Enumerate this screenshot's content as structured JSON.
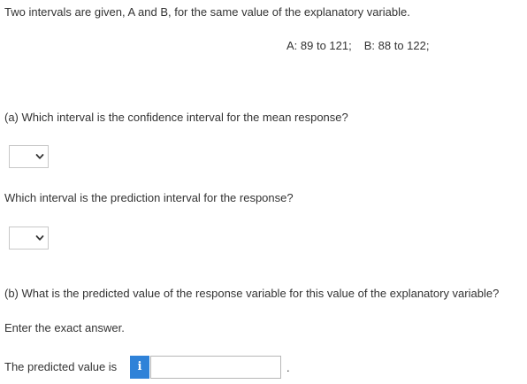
{
  "intro": "Two intervals are given, A and B, for the same value of the explanatory variable.",
  "intervals": {
    "a": "A: 89 to 121;",
    "b": "B: 88 to 122;"
  },
  "part_a": {
    "question1": "(a) Which interval is the confidence interval for the mean response?",
    "dropdown1_value": "",
    "question2": "Which interval is the prediction interval for the response?",
    "dropdown2_value": ""
  },
  "part_b": {
    "question": "(b) What is the predicted value of the response variable for this value of the explanatory variable?",
    "instruction": "Enter the exact answer.",
    "answer_label": "The predicted value is",
    "info_icon": "i",
    "answer_value": "",
    "trailing": "."
  },
  "colors": {
    "text": "#333333",
    "info_button": "#2f82d8",
    "border": "#c8c8c8"
  },
  "icons": {
    "dropdown": "chevron-down-icon",
    "info": "info-icon"
  }
}
